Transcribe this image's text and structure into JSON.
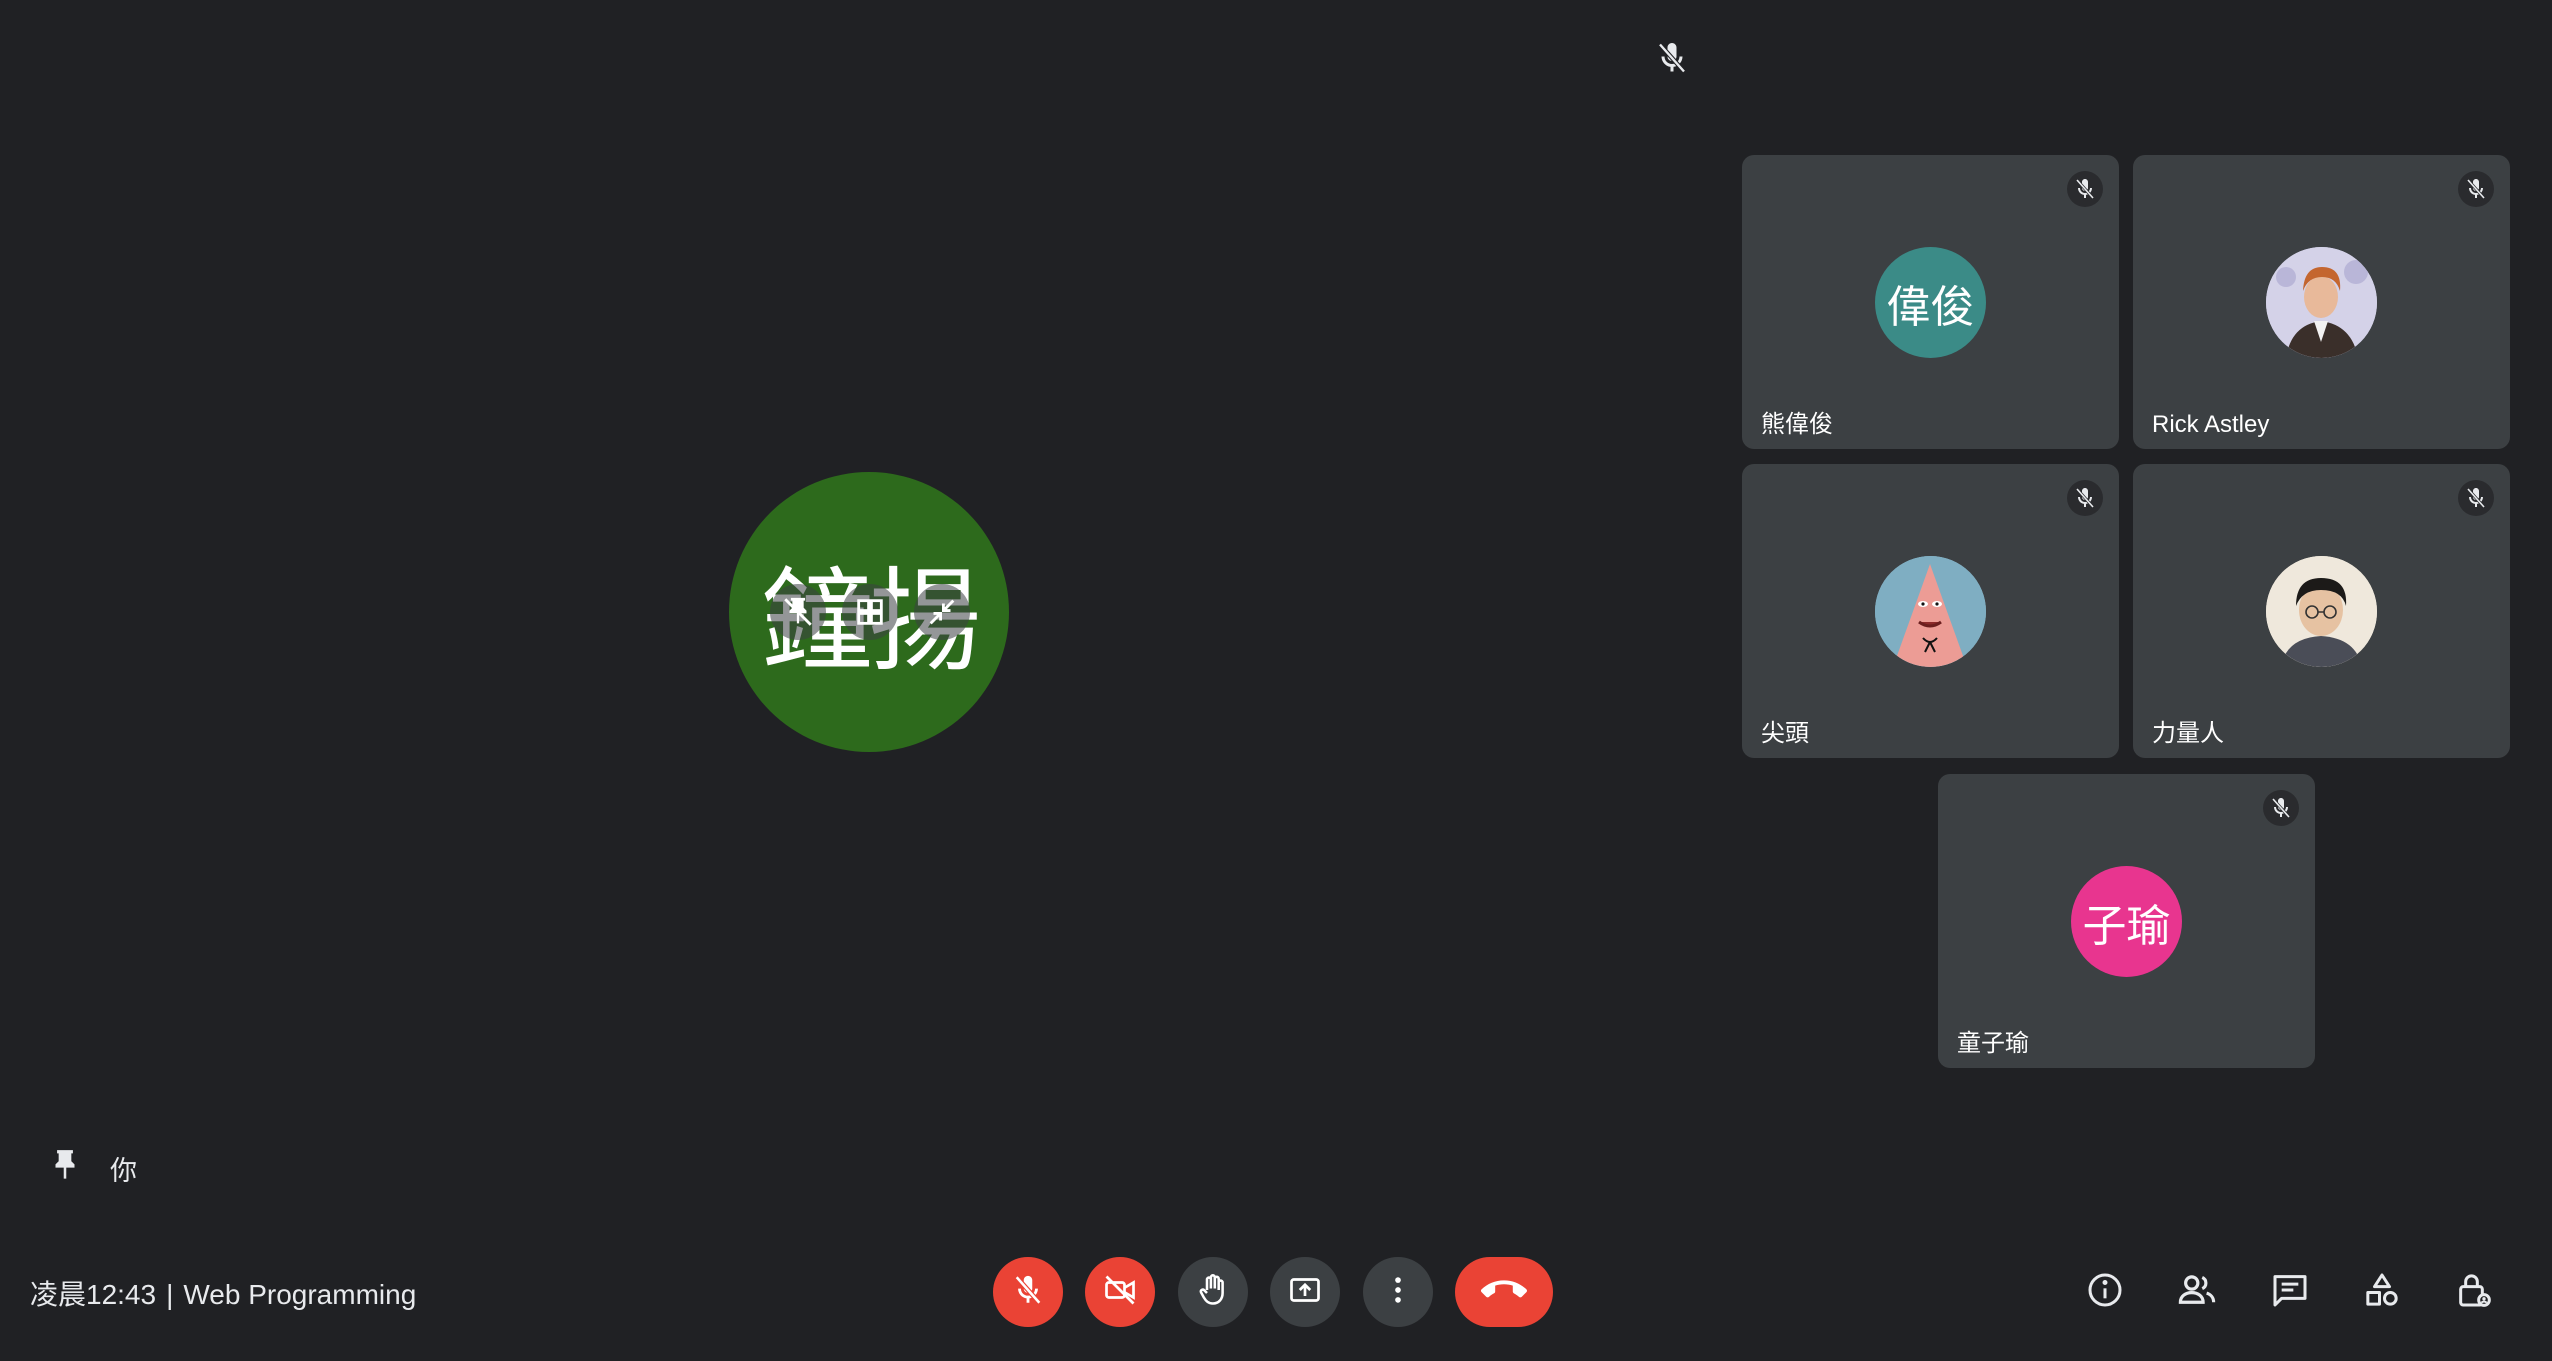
{
  "self": {
    "initials": "鐘揚",
    "label": "你",
    "avatar_color": "#2d6a1c"
  },
  "participants": [
    {
      "name": "熊偉俊",
      "initials": "偉俊",
      "avatar_type": "initials",
      "avatar_color": "#3b8b87"
    },
    {
      "name": "Rick Astley",
      "initials": "",
      "avatar_type": "photo",
      "avatar_color": "#c8c6e0"
    },
    {
      "name": "尖頭",
      "initials": "",
      "avatar_type": "photo",
      "avatar_color": "#e68a8a"
    },
    {
      "name": "力量人",
      "initials": "",
      "avatar_type": "photo",
      "avatar_color": "#d8cdb8"
    },
    {
      "name": "童子瑜",
      "initials": "子瑜",
      "avatar_type": "initials",
      "avatar_color": "#e8358f"
    }
  ],
  "meeting": {
    "time": "凌晨12:43",
    "separator": "|",
    "title": "Web Programming"
  },
  "controls": {
    "mic": "mic-off-icon",
    "camera": "camera-off-icon",
    "raise_hand": "hand-icon",
    "present": "present-screen-icon",
    "more": "more-vert-icon",
    "leave": "call-end-icon"
  },
  "side_controls": [
    "info-icon",
    "people-icon",
    "chat-icon",
    "activities-icon",
    "host-controls-icon"
  ],
  "colors": {
    "background": "#202124",
    "tile": "#3c4043",
    "danger": "#ea4335"
  }
}
